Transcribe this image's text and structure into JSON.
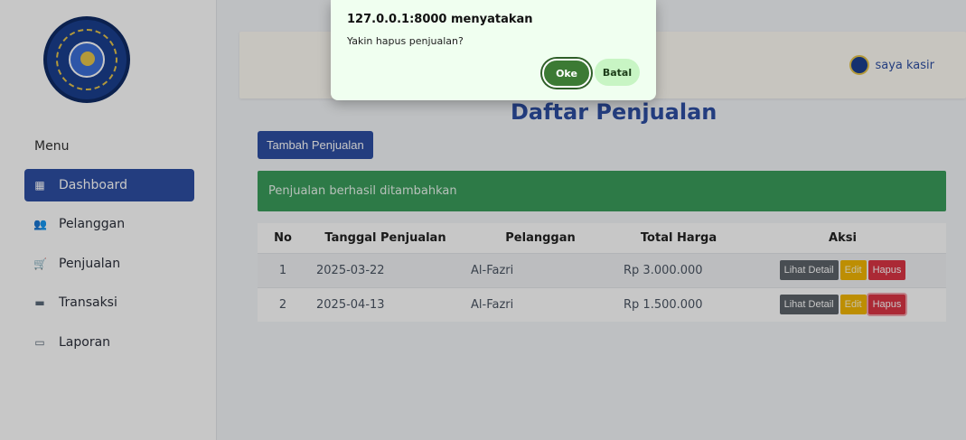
{
  "dialog": {
    "title": "127.0.0.1:8000 menyatakan",
    "message": "Yakin hapus penjualan?",
    "ok_label": "Oke",
    "cancel_label": "Batal"
  },
  "sidebar": {
    "menu_label": "Menu",
    "items": [
      {
        "label": "Dashboard",
        "icon": "grid-icon",
        "active": true
      },
      {
        "label": "Pelanggan",
        "icon": "users-icon",
        "active": false
      },
      {
        "label": "Penjualan",
        "icon": "cart-icon",
        "active": false
      },
      {
        "label": "Transaksi",
        "icon": "card-icon",
        "active": false
      },
      {
        "label": "Laporan",
        "icon": "report-icon",
        "active": false
      }
    ]
  },
  "header": {
    "user_name": "saya kasir"
  },
  "main": {
    "title": "Daftar Penjualan",
    "add_button": "Tambah Penjualan",
    "alert": "Penjualan berhasil ditambahkan",
    "table": {
      "headers": [
        "No",
        "Tanggal Penjualan",
        "Pelanggan",
        "Total Harga",
        "Aksi"
      ],
      "rows": [
        {
          "no": "1",
          "tanggal": "2025-03-22",
          "pelanggan": "Al-Fazri",
          "total": "Rp 3.000.000"
        },
        {
          "no": "2",
          "tanggal": "2025-04-13",
          "pelanggan": "Al-Fazri",
          "total": "Rp 1.500.000"
        }
      ],
      "actions": {
        "detail": "Lihat Detail",
        "edit": "Edit",
        "hapus": "Hapus"
      }
    }
  },
  "colors": {
    "primary": "#2e4fa3",
    "success": "#3a9d5b",
    "danger": "#dc3545",
    "warning": "#f2b705",
    "secondary": "#5d6369",
    "dialog_ok": "#3c7a34"
  }
}
